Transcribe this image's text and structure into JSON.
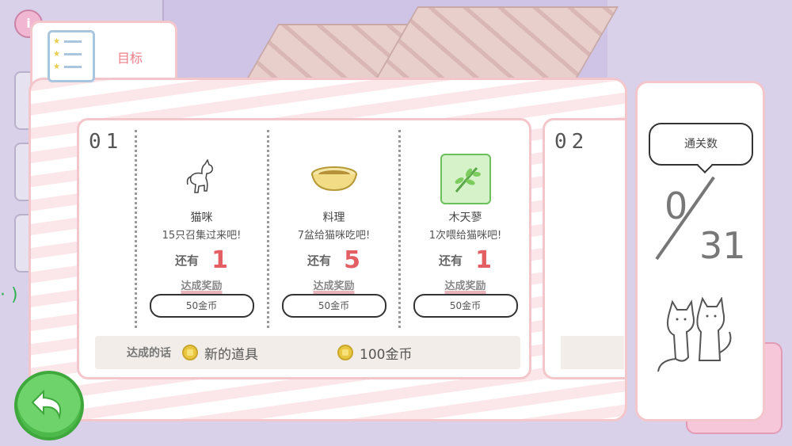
{
  "goal_tab": {
    "title": "目标",
    "icon": "checklist-icon"
  },
  "cards": [
    {
      "number": "01",
      "items": [
        {
          "icon": "cat-icon",
          "name": "猫咪",
          "desc": "15只召集过来吧!",
          "remain_label": "还有",
          "remain": "1",
          "reward_label": "达成奖励",
          "reward": "50金币"
        },
        {
          "icon": "food-bowl-icon",
          "name": "料理",
          "desc": "7盆给猫咪吃吧!",
          "remain_label": "还有",
          "remain": "5",
          "reward_label": "达成奖励",
          "reward": "50金币"
        },
        {
          "icon": "silvervine-icon",
          "name": "木天蓼",
          "desc": "1次喂给猫咪吧!",
          "remain_label": "还有",
          "remain": "1",
          "reward_label": "达成奖励",
          "reward": "50金币"
        }
      ],
      "bonus": {
        "label": "达成的话",
        "item1": "新的道具",
        "item2": "100金币"
      }
    },
    {
      "number": "02"
    }
  ],
  "clear_panel": {
    "label": "通关数",
    "current": "0",
    "total": "31"
  },
  "colors": {
    "accent": "#ee7d88",
    "remain": "#e35f63",
    "back_button": "#6ed36a",
    "panel_border": "#f3c6cc"
  },
  "back_button": {
    "icon": "back-arrow-icon"
  }
}
